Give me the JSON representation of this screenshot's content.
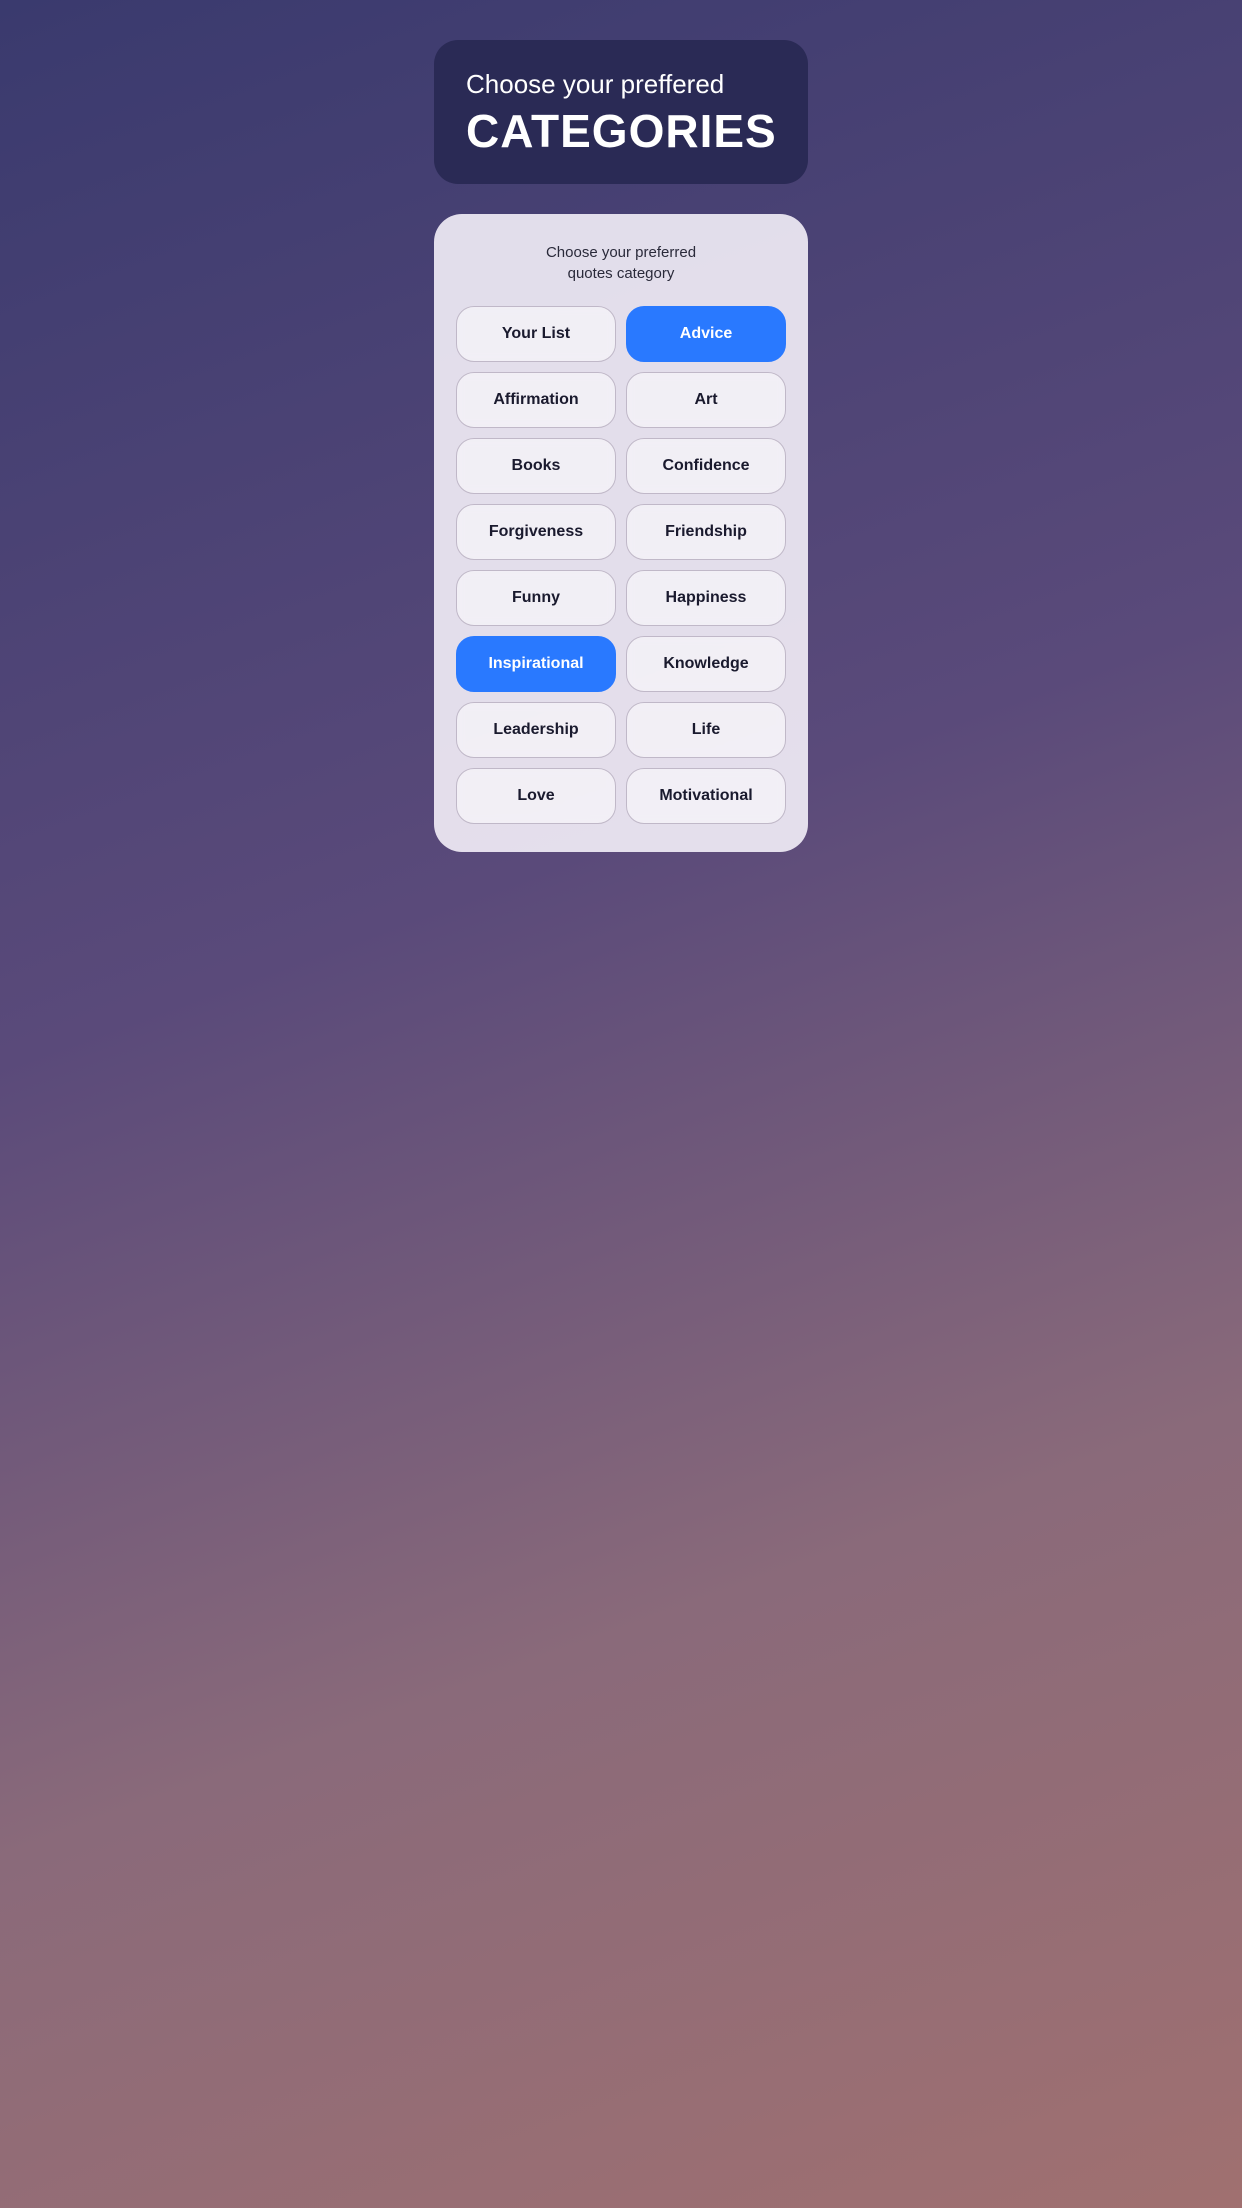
{
  "header": {
    "subtitle": "Choose your preffered",
    "title": "CATEGORIES",
    "background_color": "#2a2a55"
  },
  "card": {
    "subtitle_line1": "Choose your preferred",
    "subtitle_line2": "quotes category"
  },
  "categories": {
    "rows": [
      [
        {
          "label": "Your List",
          "active": false,
          "full": false
        },
        {
          "label": "Advice",
          "active": true,
          "full": false
        }
      ],
      [
        {
          "label": "Affirmation",
          "active": false,
          "full": false
        },
        {
          "label": "Art",
          "active": false,
          "full": false
        }
      ],
      [
        {
          "label": "Books",
          "active": false,
          "full": false
        },
        {
          "label": "Confidence",
          "active": false,
          "full": false
        }
      ],
      [
        {
          "label": "Forgiveness",
          "active": false,
          "full": false
        },
        {
          "label": "Friendship",
          "active": false,
          "full": false
        }
      ],
      [
        {
          "label": "Funny",
          "active": false,
          "full": false
        },
        {
          "label": "Happiness",
          "active": false,
          "full": false
        }
      ],
      [
        {
          "label": "Inspirational",
          "active": true,
          "full": false
        },
        {
          "label": "Knowledge",
          "active": false,
          "full": false
        }
      ],
      [
        {
          "label": "Leadership",
          "active": false,
          "full": false
        },
        {
          "label": "Life",
          "active": false,
          "full": false
        }
      ],
      [
        {
          "label": "Love",
          "active": false,
          "full": false
        },
        {
          "label": "Motivational",
          "active": false,
          "full": false
        }
      ]
    ]
  },
  "colors": {
    "active_bg": "#2979FF",
    "inactive_bg": "rgba(255,255,255,0.5)",
    "active_text": "#ffffff",
    "inactive_text": "#1a1a2e"
  }
}
